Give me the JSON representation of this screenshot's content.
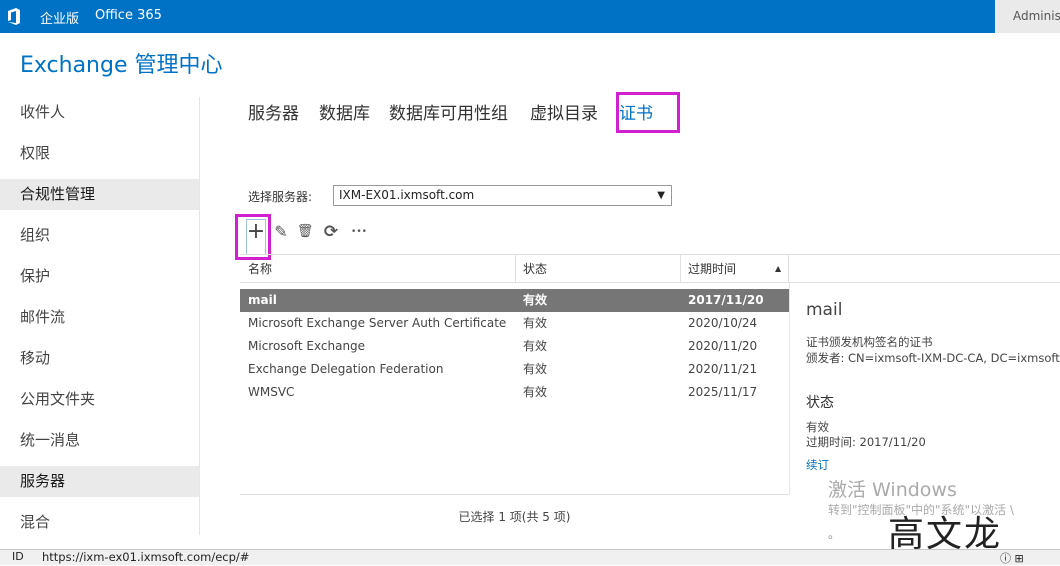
{
  "suite": {
    "edition": "企业版",
    "office": "Office 365",
    "user": "Adminis"
  },
  "app_title": "Exchange 管理中心",
  "nav": {
    "items": [
      {
        "label": "收件人"
      },
      {
        "label": "权限"
      },
      {
        "label": "合规性管理"
      },
      {
        "label": "组织"
      },
      {
        "label": "保护"
      },
      {
        "label": "邮件流"
      },
      {
        "label": "移动"
      },
      {
        "label": "公用文件夹"
      },
      {
        "label": "统一消息"
      },
      {
        "label": "服务器"
      },
      {
        "label": "混合"
      }
    ]
  },
  "tabs": [
    {
      "label": "服务器"
    },
    {
      "label": "数据库"
    },
    {
      "label": "数据库可用性组"
    },
    {
      "label": "虚拟目录"
    },
    {
      "label": "证书"
    }
  ],
  "server_select": {
    "label": "选择服务器:",
    "value": "IXM-EX01.ixmsoft.com"
  },
  "toolbar": {
    "add": "+",
    "edit": "✎",
    "delete": "🗑",
    "refresh": "⟳",
    "more": "•••"
  },
  "grid": {
    "columns": [
      "名称",
      "状态",
      "过期时间"
    ],
    "rows": [
      {
        "name": "mail",
        "status": "有效",
        "expires": "2017/11/20"
      },
      {
        "name": "Microsoft Exchange Server Auth Certificate",
        "status": "有效",
        "expires": "2020/10/24"
      },
      {
        "name": "Microsoft Exchange",
        "status": "有效",
        "expires": "2020/11/20"
      },
      {
        "name": "Exchange Delegation Federation",
        "status": "有效",
        "expires": "2020/11/21"
      },
      {
        "name": "WMSVC",
        "status": "有效",
        "expires": "2025/11/17"
      }
    ],
    "footer": "已选择 1 项(共 5 项)"
  },
  "detail": {
    "title": "mail",
    "description": "证书颁发机构签名的证书",
    "issuer": "颁发者: CN=ixmsoft-IXM-DC-CA, DC=ixmsoft, D",
    "status_heading": "状态",
    "status_value": "有效",
    "expires": "过期时间: 2017/11/20",
    "renew": "续订"
  },
  "watermark": {
    "title": "激活 Windows",
    "sub": "转到\"控制面板\"中的\"系统\"以激活 \\",
    "dot": "。",
    "signature": "高文龙"
  },
  "statusbar": {
    "icon": "ID",
    "url": "https://ixm-ex01.ixmsoft.com/ecp/#",
    "right": "ⓘ ⊞"
  },
  "colors": {
    "brand": "#0072c6",
    "highlight": "#d020d0",
    "selected_row": "#767676"
  }
}
